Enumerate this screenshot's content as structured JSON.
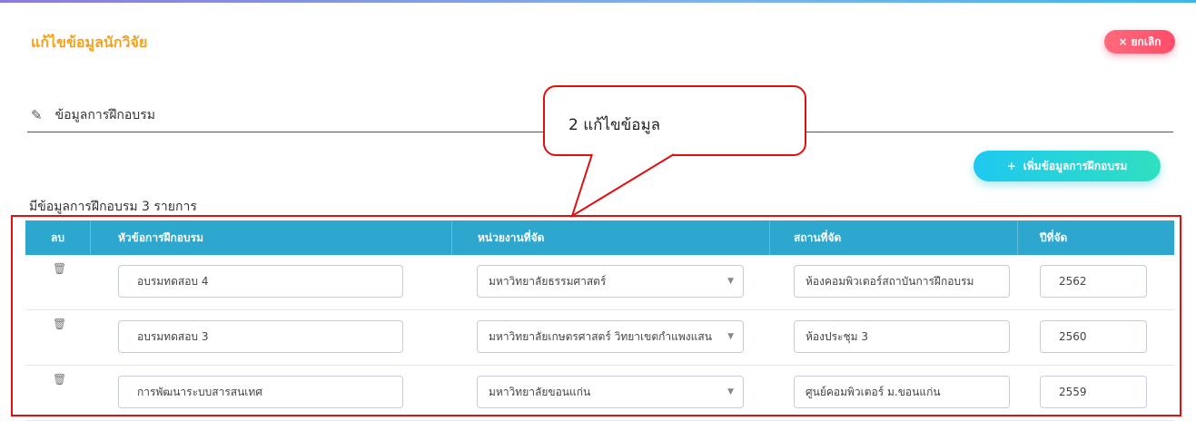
{
  "header": {
    "title": "แก้ไขข้อมูลนักวิจัย",
    "cancel_icon": "×",
    "cancel_label": "ยกเลิก"
  },
  "section": {
    "icon": "edit-icon",
    "title": "ข้อมูลการฝึกอบรม"
  },
  "add_button": {
    "icon": "+",
    "label": "เพิ่มข้อมูลการฝึกอบรม"
  },
  "count_text": "มีข้อมูลการฝึกอบรม 3 รายการ",
  "callout": {
    "text": "2 แก้ไขข้อมูล"
  },
  "table": {
    "headers": [
      "ลบ",
      "หัวข้อการฝึกอบรม",
      "หน่วยงานที่จัด",
      "สถานที่จัด",
      "ปีที่จัด"
    ],
    "rows": [
      {
        "title": "อบรมทดสอบ 4",
        "org": "มหาวิทยาลัยธรรมศาสตร์",
        "place": "ห้องคอมพิวเตอร์สถาบันการฝึกอบรม",
        "year": "2562"
      },
      {
        "title": "อบรมทดสอบ 3",
        "org": "มหาวิทยาลัยเกษตรศาสตร์ วิทยาเขตกำแพงแสน",
        "place": "ห้องประชุม 3",
        "year": "2560"
      },
      {
        "title": "การพัฒนาระบบสารสนเทศ",
        "org": "มหาวิทยาลัยขอนแก่น",
        "place": "ศูนย์คอมพิวเตอร์ ม.ขอนแก่น",
        "year": "2559"
      }
    ]
  },
  "colors": {
    "title": "#f5a21b",
    "header_bg": "#2ea7cf",
    "cancel": "#ff4d6a",
    "annotation": "#e01010"
  }
}
